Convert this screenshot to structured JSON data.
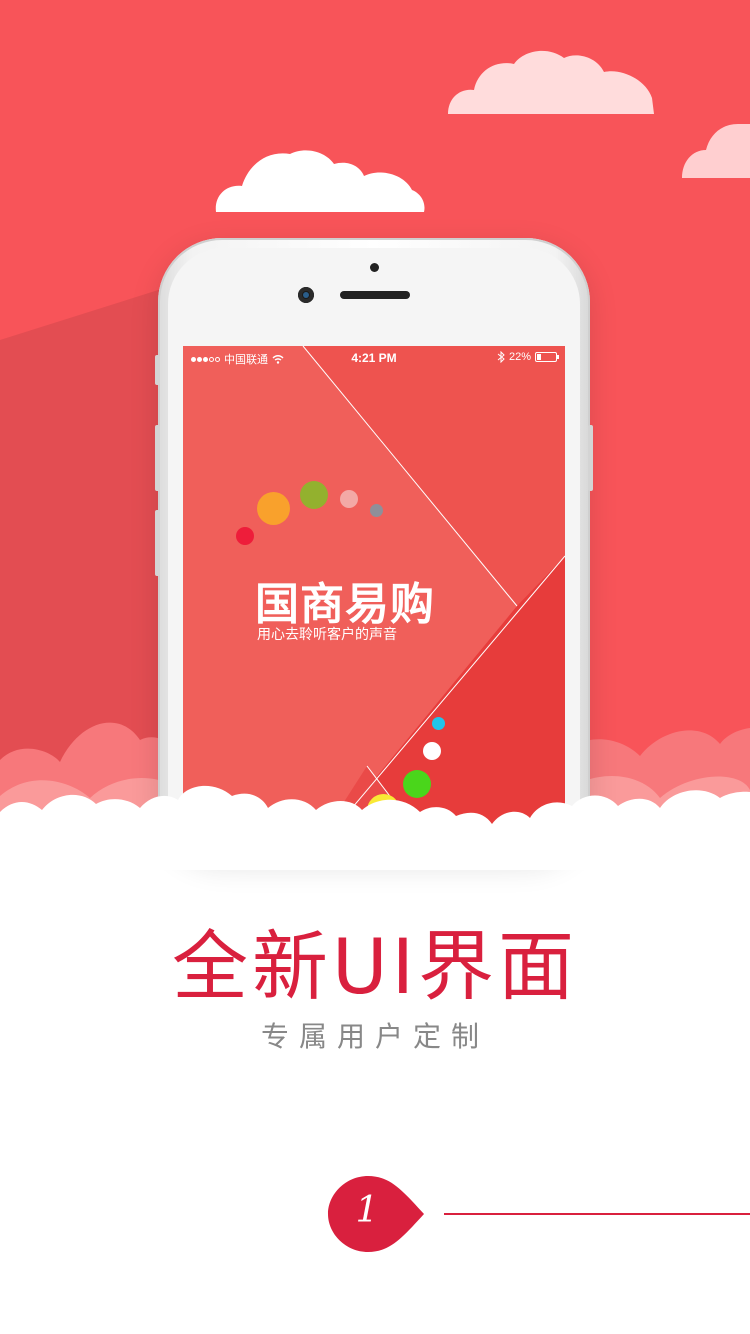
{
  "colors": {
    "hero_bg": "#f85459",
    "accent": "#d9203e",
    "screen_bg": "#f05f5a",
    "subtitle_gray": "#888888"
  },
  "status_bar": {
    "carrier": "中国联通",
    "time": "4:21 PM",
    "battery": "22%",
    "icons": [
      "signal-dots-icon",
      "wifi-icon",
      "bluetooth-icon",
      "battery-icon"
    ]
  },
  "splash": {
    "app_name": "国商易购",
    "slogan": "用心去聆听客户的声音"
  },
  "headline": "全新UI界面",
  "subheadline": "专属用户定制",
  "pagination": {
    "current": "1"
  }
}
